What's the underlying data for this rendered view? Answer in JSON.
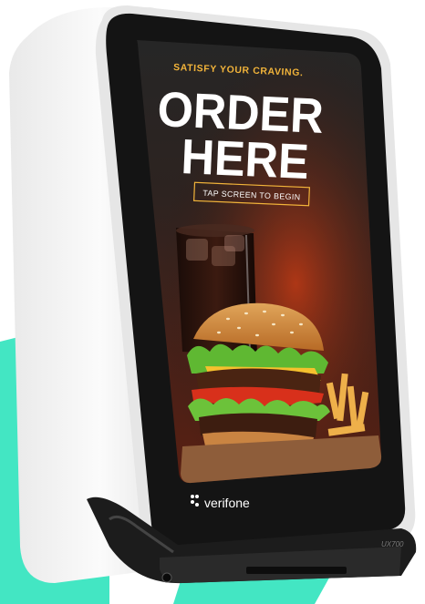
{
  "ad": {
    "tagline": "SATISFY YOUR CRAVING.",
    "headline_line1": "ORDER",
    "headline_line2": "HERE",
    "cta": "TAP SCREEN TO BEGIN"
  },
  "device": {
    "brand": "verifone",
    "model": "UX700"
  },
  "colors": {
    "accent": "#f2b43a",
    "backdrop": "#43e6c3",
    "screen_bezel": "#151515",
    "casing": "#f4f4f4"
  }
}
